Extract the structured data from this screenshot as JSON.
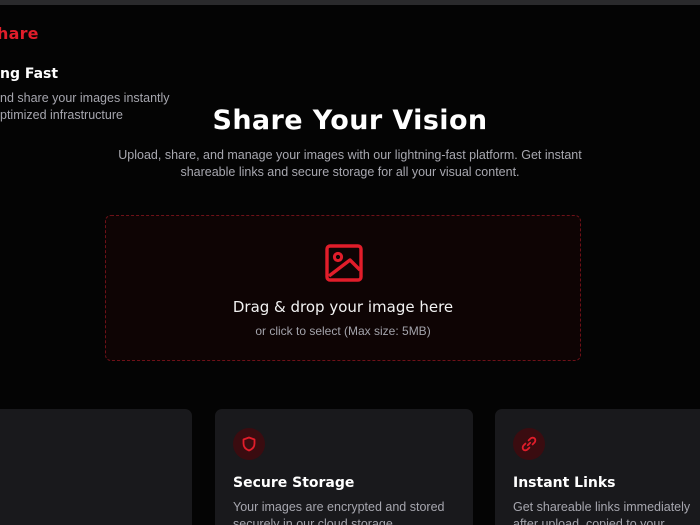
{
  "header": {
    "brand": "hare"
  },
  "hero": {
    "title": "Share Your Vision",
    "subtitle": "Upload, share, and manage your images with our lightning-fast platform. Get instant shareable links and secure storage for all your visual content."
  },
  "dropzone": {
    "title": "Drag & drop your image here",
    "hint": "or click to select (Max size: 5MB)",
    "icon": "image-icon"
  },
  "features": [
    {
      "title_visible": "ng Fast",
      "desc_line1": "nd share your images instantly",
      "desc_line2": "ptimized infrastructure",
      "icon": "bolt-icon"
    },
    {
      "title": "Secure Storage",
      "desc": "Your images are encrypted and stored securely in our cloud storage",
      "icon": "shield-icon"
    },
    {
      "title": "Instant Links",
      "desc": "Get shareable links immediately after upload, copied to your clipboard",
      "icon": "link-icon"
    }
  ],
  "colors": {
    "accent": "#e11d2a",
    "background": "#040404",
    "card": "#19191c"
  }
}
